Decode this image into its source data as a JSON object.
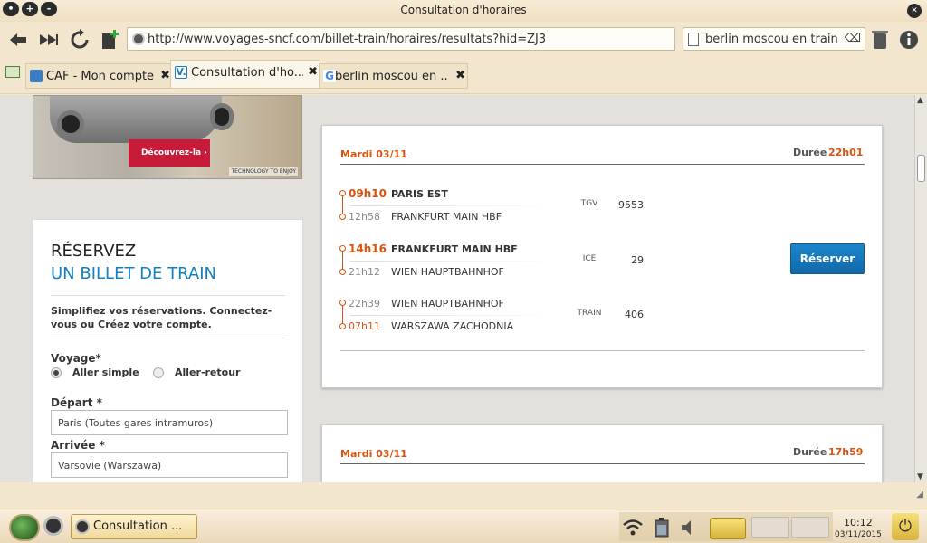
{
  "window": {
    "title": "Consultation d'horaires"
  },
  "toolbar": {
    "url": "http://www.voyages-sncf.com/billet-train/horaires/resultats?hid=ZJ3",
    "search_text": "berlin moscou en train"
  },
  "tabs": [
    {
      "label": "CAF - Mon compte"
    },
    {
      "label": "Consultation d'ho..."
    },
    {
      "label": "berlin moscou en ..."
    }
  ],
  "ad": {
    "button_label": "Découvrez-la",
    "tagline": "TECHNOLOGY TO ENJOY"
  },
  "booking": {
    "title_line1": "RÉSERVEZ",
    "title_line2": "UN BILLET DE TRAIN",
    "intro": "Simplifiez vos réservations. Connectez-vous ou Créez votre compte.",
    "voyage_label": "Voyage*",
    "option_one_way": "Aller simple",
    "option_return": "Aller-retour",
    "depart_label": "Départ *",
    "depart_value": "Paris (Toutes gares intramuros)",
    "arrivee_label": "Arrivée *",
    "arrivee_value": "Varsovie (Warszawa)"
  },
  "results": [
    {
      "date": "Mardi 03/11",
      "duration_label": "Durée",
      "duration": "22h01",
      "legs": [
        {
          "dep_time": "09h10",
          "dep_station": "PARIS EST",
          "arr_time": "12h58",
          "arr_station": "FRANKFURT MAIN HBF",
          "type": "TGV",
          "number": "9553"
        },
        {
          "dep_time": "14h16",
          "dep_station": "FRANKFURT MAIN HBF",
          "arr_time": "21h12",
          "arr_station": "WIEN HAUPTBAHNHOF",
          "type": "ICE",
          "number": "29"
        },
        {
          "dep_time": "22h39",
          "dep_station": "WIEN HAUPTBAHNHOF",
          "arr_time": "07h11",
          "arr_station": "WARSZAWA ZACHODNIA",
          "type": "TRAIN",
          "number": "406"
        }
      ],
      "reserve_label": "Réserver"
    },
    {
      "date": "Mardi 03/11",
      "duration_label": "Durée",
      "duration": "17h59"
    }
  ],
  "taskbar": {
    "task_label": "Consultation ...",
    "clock_time": "10:12",
    "clock_date": "03/11/2015"
  },
  "icons": {
    "back": "back-arrow-icon",
    "forward": "fast-forward-icon",
    "reload": "reload-icon",
    "bookmark": "bookmark-add-icon",
    "trash": "trash-icon",
    "info": "info-icon"
  },
  "colors": {
    "accent_orange": "#d9530f",
    "accent_blue": "#1380c3",
    "button_blue": "#1773b5"
  }
}
